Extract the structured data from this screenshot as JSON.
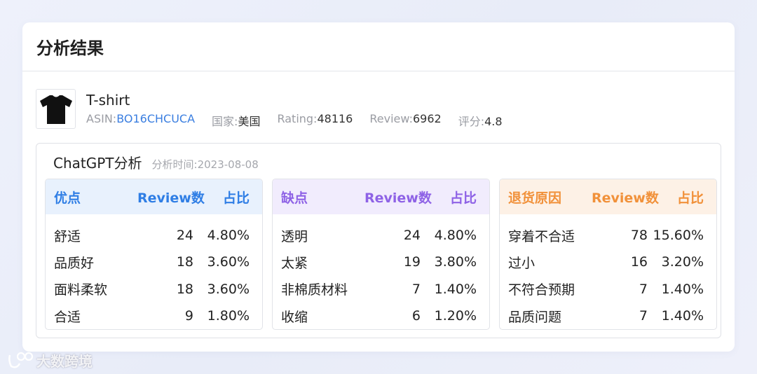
{
  "header": {
    "title": "分析结果"
  },
  "product": {
    "name": "T-shirt",
    "asin_label": "ASIN:",
    "asin": "BO16CHCUCA",
    "country_label": "国家:",
    "country": "美国",
    "rating_label": "Rating:",
    "rating": "48116",
    "review_label": "Review:",
    "review": "6962",
    "score_label": "评分:",
    "score": "4.8"
  },
  "analysis": {
    "title": "ChatGPT分析",
    "time_label": "分析时间:",
    "time": "2023-08-08"
  },
  "panels": [
    {
      "head": [
        "优点",
        "Review数",
        "占比"
      ],
      "color": "#2f7ee5",
      "rows": [
        [
          "舒适",
          "24",
          "4.80%"
        ],
        [
          "品质好",
          "18",
          "3.60%"
        ],
        [
          "面料柔软",
          "18",
          "3.60%"
        ],
        [
          "合适",
          "9",
          "1.80%"
        ]
      ]
    },
    {
      "head": [
        "缺点",
        "Review数",
        "占比"
      ],
      "color": "#8e62e6",
      "rows": [
        [
          "透明",
          "24",
          "4.80%"
        ],
        [
          "太紧",
          "19",
          "3.80%"
        ],
        [
          "非棉质材料",
          "7",
          "1.40%"
        ],
        [
          "收缩",
          "6",
          "1.20%"
        ]
      ]
    },
    {
      "head": [
        "退货原因",
        "Review数",
        "占比"
      ],
      "color": "#f1913a",
      "rows": [
        [
          "穿着不合适",
          "78",
          "15.60%"
        ],
        [
          "过小",
          "16",
          "3.20%"
        ],
        [
          "不符合预期",
          "7",
          "1.40%"
        ],
        [
          "品质问题",
          "7",
          "1.40%"
        ]
      ]
    }
  ],
  "watermark": {
    "text": "大数跨境"
  }
}
